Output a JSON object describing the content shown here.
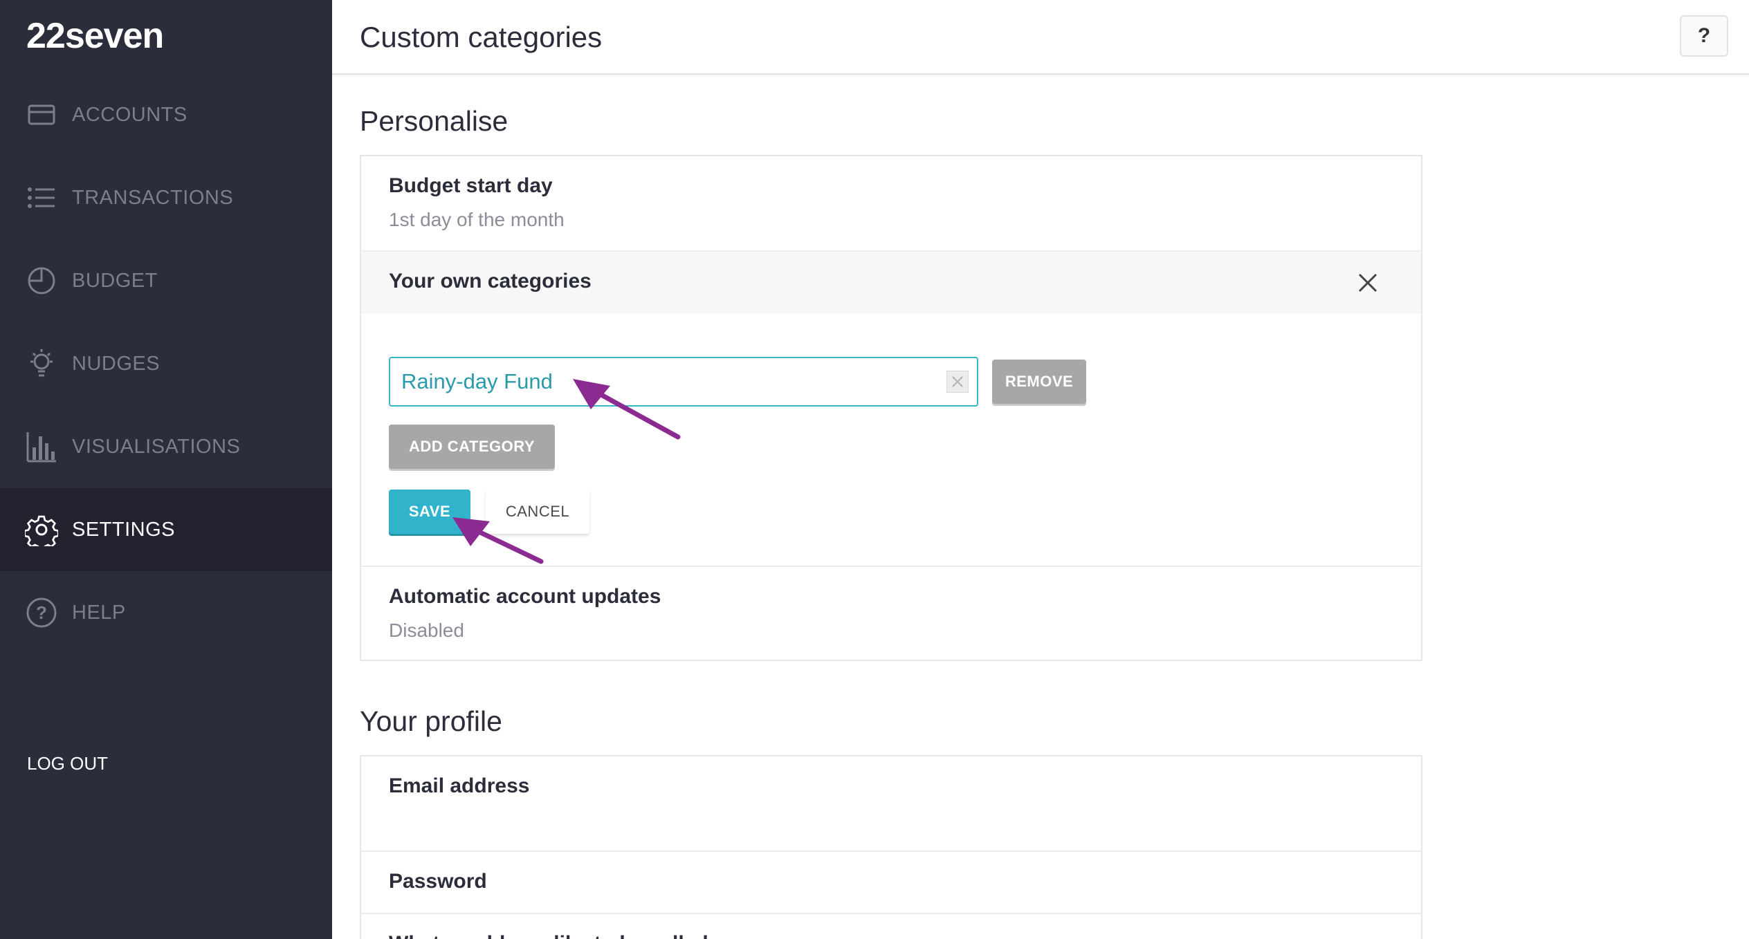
{
  "app": {
    "logo": "22seven"
  },
  "sidebar": {
    "items": [
      {
        "label": "ACCOUNTS",
        "icon": "card-icon"
      },
      {
        "label": "TRANSACTIONS",
        "icon": "list-icon"
      },
      {
        "label": "BUDGET",
        "icon": "pie-icon"
      },
      {
        "label": "NUDGES",
        "icon": "lightbulb-icon"
      },
      {
        "label": "VISUALISATIONS",
        "icon": "bar-chart-icon"
      },
      {
        "label": "SETTINGS",
        "icon": "gear-icon",
        "active": true
      },
      {
        "label": "HELP",
        "icon": "help-circle-icon"
      }
    ],
    "logout": "LOG OUT"
  },
  "header": {
    "title": "Custom categories",
    "help": "?"
  },
  "personalise": {
    "title": "Personalise",
    "budget_start": {
      "title": "Budget start day",
      "value": "1st day of the month"
    },
    "categories": {
      "title": "Your own categories",
      "input_value": "Rainy-day Fund",
      "remove_label": "REMOVE",
      "add_label": "ADD CATEGORY",
      "save_label": "SAVE",
      "cancel_label": "CANCEL"
    },
    "auto_updates": {
      "title": "Automatic account updates",
      "value": "Disabled"
    }
  },
  "profile": {
    "title": "Your profile",
    "email": {
      "title": "Email address"
    },
    "password": {
      "title": "Password"
    },
    "next_row": {
      "title": "What would you like to be called"
    }
  },
  "colors": {
    "accent": "#31b4cb",
    "sidebar": "#2b2d3b",
    "annotation": "#8b2a91"
  }
}
